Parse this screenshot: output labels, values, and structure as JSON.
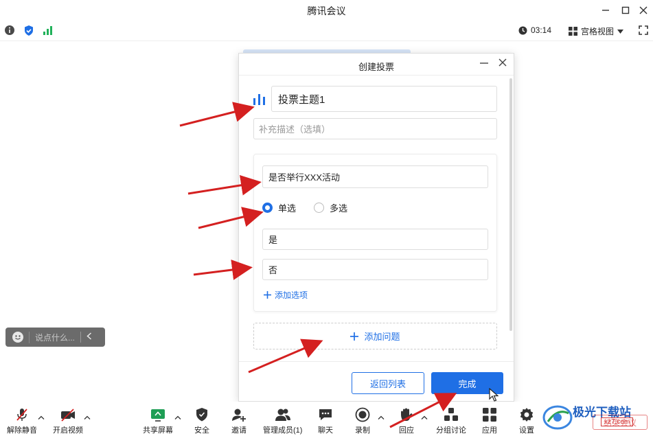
{
  "window": {
    "title": "腾讯会议"
  },
  "infobar": {
    "timer": "03:14",
    "view_mode": "宫格视图"
  },
  "chat": {
    "placeholder": "说点什么..."
  },
  "dialog": {
    "title": "创建投票",
    "topic": "投票主题1",
    "description_placeholder": "补充描述（选填）",
    "question": "是否举行XXX活动",
    "single_choice": "单选",
    "multi_choice": "多选",
    "selected_mode": "单选",
    "options": [
      "是",
      "否"
    ],
    "add_option": "添加选项",
    "add_question": "添加问题",
    "back_button": "返回列表",
    "done_button": "完成"
  },
  "toolbar": {
    "items": [
      "解除静音",
      "开启视频",
      "共享屏幕",
      "安全",
      "邀请",
      "管理成员(1)",
      "聊天",
      "录制",
      "回应",
      "分组讨论",
      "应用",
      "设置"
    ],
    "end_meeting": "结束会议"
  },
  "watermark": {
    "brand": "极光下载站",
    "site": "xz7.com"
  },
  "colors": {
    "accent": "#1f6fe5",
    "arrow": "#d42020",
    "secure": "#1f6fe5",
    "signal": "#21b15a"
  }
}
